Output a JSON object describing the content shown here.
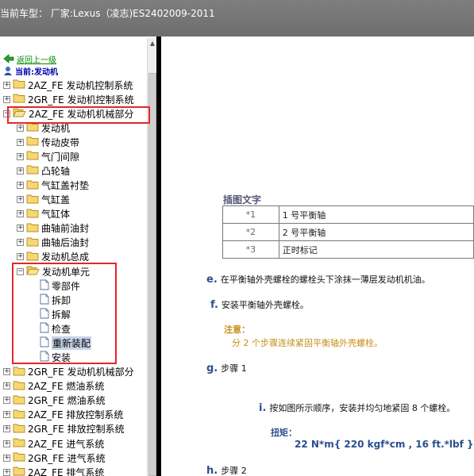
{
  "title": "当前车型：  厂家:Lexus（凌志)ES2402009-2011",
  "nav": {
    "back": "返回上一级",
    "current": "当前:发动机"
  },
  "tree": [
    {
      "label": "2AZ_FE 发动机控制系统",
      "expander": "+",
      "level": 0,
      "type": "folder"
    },
    {
      "label": "2GR_FE 发动机控制系统",
      "expander": "+",
      "level": 0,
      "type": "folder"
    },
    {
      "label": "2AZ_FE 发动机机械部分",
      "expander": "-",
      "level": 0,
      "type": "folder-open"
    },
    {
      "label": "发动机",
      "expander": "+",
      "level": 1,
      "type": "folder"
    },
    {
      "label": "传动皮带",
      "expander": "+",
      "level": 1,
      "type": "folder"
    },
    {
      "label": "气门间隙",
      "expander": "+",
      "level": 1,
      "type": "folder"
    },
    {
      "label": "凸轮轴",
      "expander": "+",
      "level": 1,
      "type": "folder"
    },
    {
      "label": "气缸盖衬垫",
      "expander": "+",
      "level": 1,
      "type": "folder"
    },
    {
      "label": "气缸盖",
      "expander": "+",
      "level": 1,
      "type": "folder"
    },
    {
      "label": "气缸体",
      "expander": "+",
      "level": 1,
      "type": "folder"
    },
    {
      "label": "曲轴前油封",
      "expander": "+",
      "level": 1,
      "type": "folder"
    },
    {
      "label": "曲轴后油封",
      "expander": "+",
      "level": 1,
      "type": "folder"
    },
    {
      "label": "发动机总成",
      "expander": "+",
      "level": 1,
      "type": "folder"
    },
    {
      "label": "发动机单元",
      "expander": "-",
      "level": 1,
      "type": "folder-open"
    },
    {
      "label": "零部件",
      "expander": "",
      "level": 2,
      "type": "page"
    },
    {
      "label": "拆卸",
      "expander": "",
      "level": 2,
      "type": "page"
    },
    {
      "label": "拆解",
      "expander": "",
      "level": 2,
      "type": "page"
    },
    {
      "label": "检查",
      "expander": "",
      "level": 2,
      "type": "page"
    },
    {
      "label": "重新装配",
      "expander": "",
      "level": 2,
      "type": "page",
      "selected": true
    },
    {
      "label": "安装",
      "expander": "",
      "level": 2,
      "type": "page"
    },
    {
      "label": "2GR_FE 发动机机械部分",
      "expander": "+",
      "level": 0,
      "type": "folder"
    },
    {
      "label": "2AZ_FE 燃油系统",
      "expander": "+",
      "level": 0,
      "type": "folder"
    },
    {
      "label": "2GR_FE 燃油系统",
      "expander": "+",
      "level": 0,
      "type": "folder"
    },
    {
      "label": "2AZ_FE 排放控制系统",
      "expander": "+",
      "level": 0,
      "type": "folder"
    },
    {
      "label": "2GR_FE 排放控制系统",
      "expander": "+",
      "level": 0,
      "type": "folder"
    },
    {
      "label": "2AZ_FE 进气系统",
      "expander": "+",
      "level": 0,
      "type": "folder"
    },
    {
      "label": "2GR_FE 进气系统",
      "expander": "+",
      "level": 0,
      "type": "folder"
    },
    {
      "label": "2AZ_FE 排气系统",
      "expander": "+",
      "level": 0,
      "type": "folder"
    }
  ],
  "doc": {
    "caption_title": "插图文字",
    "legend": [
      {
        "num": "*1",
        "text": "1 号平衡轴"
      },
      {
        "num": "*2",
        "text": "2 号平衡轴"
      },
      {
        "num": "*3",
        "text": "正时标记"
      }
    ],
    "steps": {
      "e": {
        "marker": "e.",
        "text": "在平衡轴外壳螺栓的螺栓头下涂抹一薄层发动机机油。"
      },
      "f": {
        "marker": "f.",
        "text": "安装平衡轴外壳螺栓。"
      },
      "g": {
        "marker": "g.",
        "text": "步骤 1"
      },
      "i": {
        "marker": "i.",
        "text": "按如图所示顺序，安装并均匀地紧固 8 个螺栓。"
      },
      "h": {
        "marker": "h.",
        "text": "步骤 2"
      }
    },
    "note_heading": "注意：",
    "note_body": "分 2 个步骤连续紧固平衡轴外壳螺栓。",
    "torque_heading": "扭矩：",
    "torque_value": "22 N*m{ 220 kgf*cm , 16 ft.*lbf }"
  },
  "colors": {
    "titlebar": "#6e6e6e",
    "highlight_box": "#e0282c",
    "step_marker": "#2a4f8f",
    "note": "#c88d1a",
    "selected_bg": "#c8d4e8"
  }
}
